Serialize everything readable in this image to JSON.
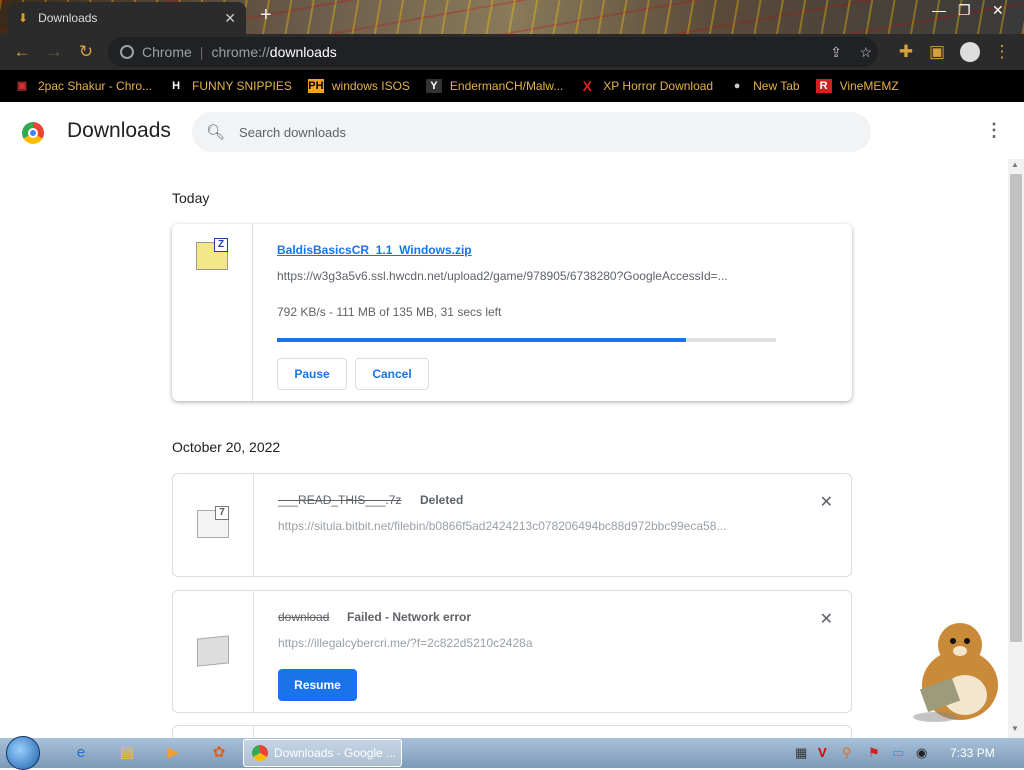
{
  "window": {
    "tab_title": "Downloads",
    "new_tab_symbol": "+"
  },
  "omnibox": {
    "site_label": "Chrome",
    "url_scheme": "chrome://",
    "url_path": "downloads"
  },
  "bookmarks": [
    {
      "label": "2pac Shakur - Chro...",
      "icon": "video-icon",
      "color": "#cc3333"
    },
    {
      "label": "FUNNY SNIPPIES",
      "icon": "h-icon",
      "color": "#ffffff"
    },
    {
      "label": "windows ISOS",
      "icon": "ph-icon",
      "color": "#f7a21b"
    },
    {
      "label": "EndermanCH/Malw...",
      "icon": "yp-icon",
      "color": "#ffffff"
    },
    {
      "label": "XP Horror Download",
      "icon": "x-icon",
      "color": "#e02020"
    },
    {
      "label": "New Tab",
      "icon": "globe-icon",
      "color": "#cccccc"
    },
    {
      "label": "VineMEMZ",
      "icon": "r-icon",
      "color": "#d02020"
    }
  ],
  "header": {
    "title": "Downloads",
    "search_placeholder": "Search downloads"
  },
  "sections": [
    {
      "date": "Today",
      "items": [
        {
          "filename": "BaldisBasicsCR_1.1_Windows.zip",
          "url": "https://w3g3a5v6.ssl.hwcdn.net/upload2/game/978905/6738280?GoogleAccessId=...",
          "status": "792 KB/s - 111 MB of 135 MB, 31 secs left",
          "progress": 0.82,
          "buttons": [
            "Pause",
            "Cancel"
          ]
        }
      ]
    },
    {
      "date": "October 20, 2022",
      "items": [
        {
          "filename": "___READ_THIS___.7z",
          "state": "Deleted",
          "url": "https://situla.bitbit.net/filebin/b0866f5ad2424213c078206494bc88d972bbc99eca58..."
        },
        {
          "filename": "download",
          "state": "Failed - Network error",
          "url": "https://illegalcybercri.me/?f=2c822d5210c2428a",
          "button": "Resume"
        }
      ]
    }
  ],
  "taskbar": {
    "chrome_task_label": "Downloads - Google ...",
    "clock": "7:33 PM"
  },
  "colors": {
    "accent": "#1a73e8",
    "bookmark_text": "#e6b24a"
  }
}
